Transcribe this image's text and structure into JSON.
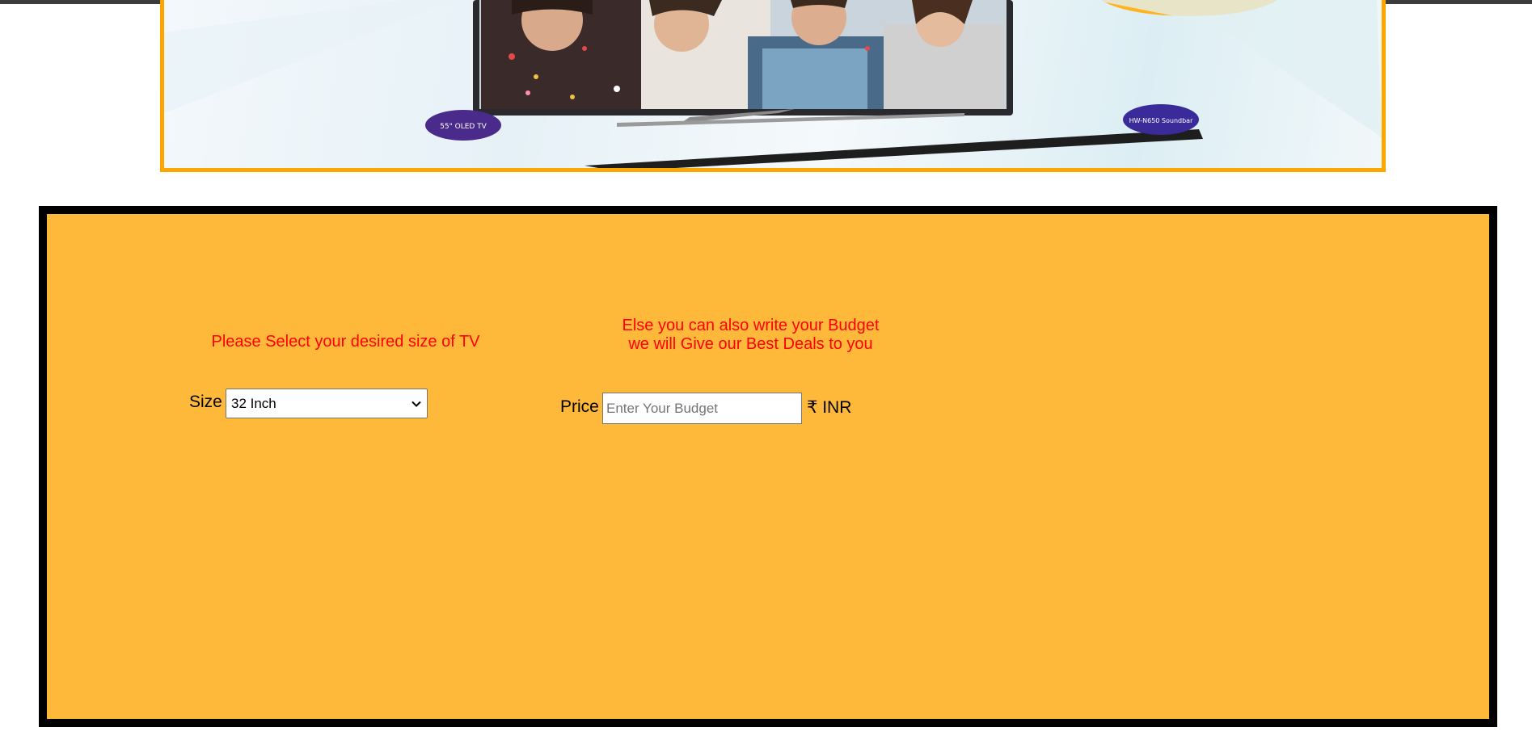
{
  "banner": {
    "badge_left": "55\" OLED TV",
    "badge_right": "HW-N650 Soundbar"
  },
  "form": {
    "size_heading": "Please Select your desired size of TV",
    "size_label": "Size",
    "size_selected": "32 Inch",
    "budget_heading_line1": "Else you can also write your Budget",
    "budget_heading_line2": "we will Give our Best Deals to you",
    "price_label": "Price",
    "price_placeholder": "Enter Your Budget",
    "currency": "₹ INR"
  },
  "colors": {
    "banner_border": "#ffa500",
    "panel_background": "#ffb93a",
    "panel_border": "#000000",
    "heading_text": "#ff0000"
  }
}
